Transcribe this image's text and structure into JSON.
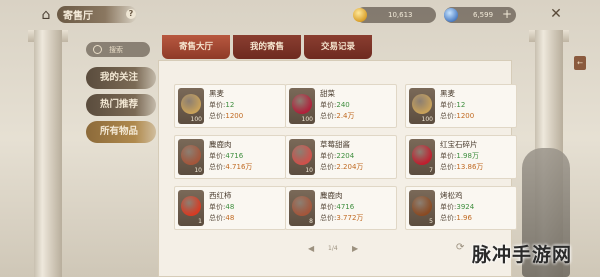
{
  "header": {
    "title": "寄售厅",
    "help_label": "?",
    "gold_amount": "10,613",
    "gem_amount": "6,599",
    "plus_label": "+",
    "home_icon": "home-icon",
    "close_icon": "close-icon",
    "side_tab_label": "←"
  },
  "search": {
    "label": "搜索"
  },
  "nav": {
    "items": [
      {
        "label": "我的关注"
      },
      {
        "label": "热门推荐"
      },
      {
        "label": "所有物品"
      }
    ],
    "active_index": 2
  },
  "tabs": [
    {
      "label": "寄售大厅"
    },
    {
      "label": "我的寄售"
    },
    {
      "label": "交易记录"
    }
  ],
  "items": [
    {
      "name": "黑麦",
      "price_label": "单价:",
      "price": "12",
      "total_label": "总价:",
      "total": "1200",
      "qty": "100",
      "icon_color": "#c9a25a"
    },
    {
      "name": "甜菜",
      "price_label": "单价:",
      "price": "240",
      "total_label": "总价:",
      "total": "2.4万",
      "qty": "100",
      "icon_color": "#b0203a"
    },
    {
      "name": "黑麦",
      "price_label": "单价:",
      "price": "12",
      "total_label": "总价:",
      "total": "1200",
      "qty": "100",
      "icon_color": "#c9a25a"
    },
    {
      "name": "麋鹿肉",
      "price_label": "单价:",
      "price": "4716",
      "total_label": "总价:",
      "total": "4.716万",
      "qty": "10",
      "icon_color": "#a4553a"
    },
    {
      "name": "草莓甜酱",
      "price_label": "单价:",
      "price": "2204",
      "total_label": "总价:",
      "total": "2.204万",
      "qty": "10",
      "icon_color": "#d0504a"
    },
    {
      "name": "红宝石碎片",
      "price_label": "单价:",
      "price": "1.98万",
      "total_label": "总价:",
      "total": "13.86万",
      "qty": "7",
      "icon_color": "#c01e2e"
    },
    {
      "name": "西红柿",
      "price_label": "单价:",
      "price": "48",
      "total_label": "总价:",
      "total": "48",
      "qty": "1",
      "icon_color": "#d83a22"
    },
    {
      "name": "麋鹿肉",
      "price_label": "单价:",
      "price": "4716",
      "total_label": "总价:",
      "total": "3.772万",
      "qty": "8",
      "icon_color": "#a4553a"
    },
    {
      "name": "烤松鸡",
      "price_label": "单价:",
      "price": "3924",
      "total_label": "总价:",
      "total": "1.96",
      "qty": "5",
      "icon_color": "#8a4a22"
    }
  ],
  "pager": {
    "prev": "◀",
    "text": "1/4",
    "next": "▶",
    "refresh": "⟳"
  },
  "watermark": "脉冲手游网"
}
